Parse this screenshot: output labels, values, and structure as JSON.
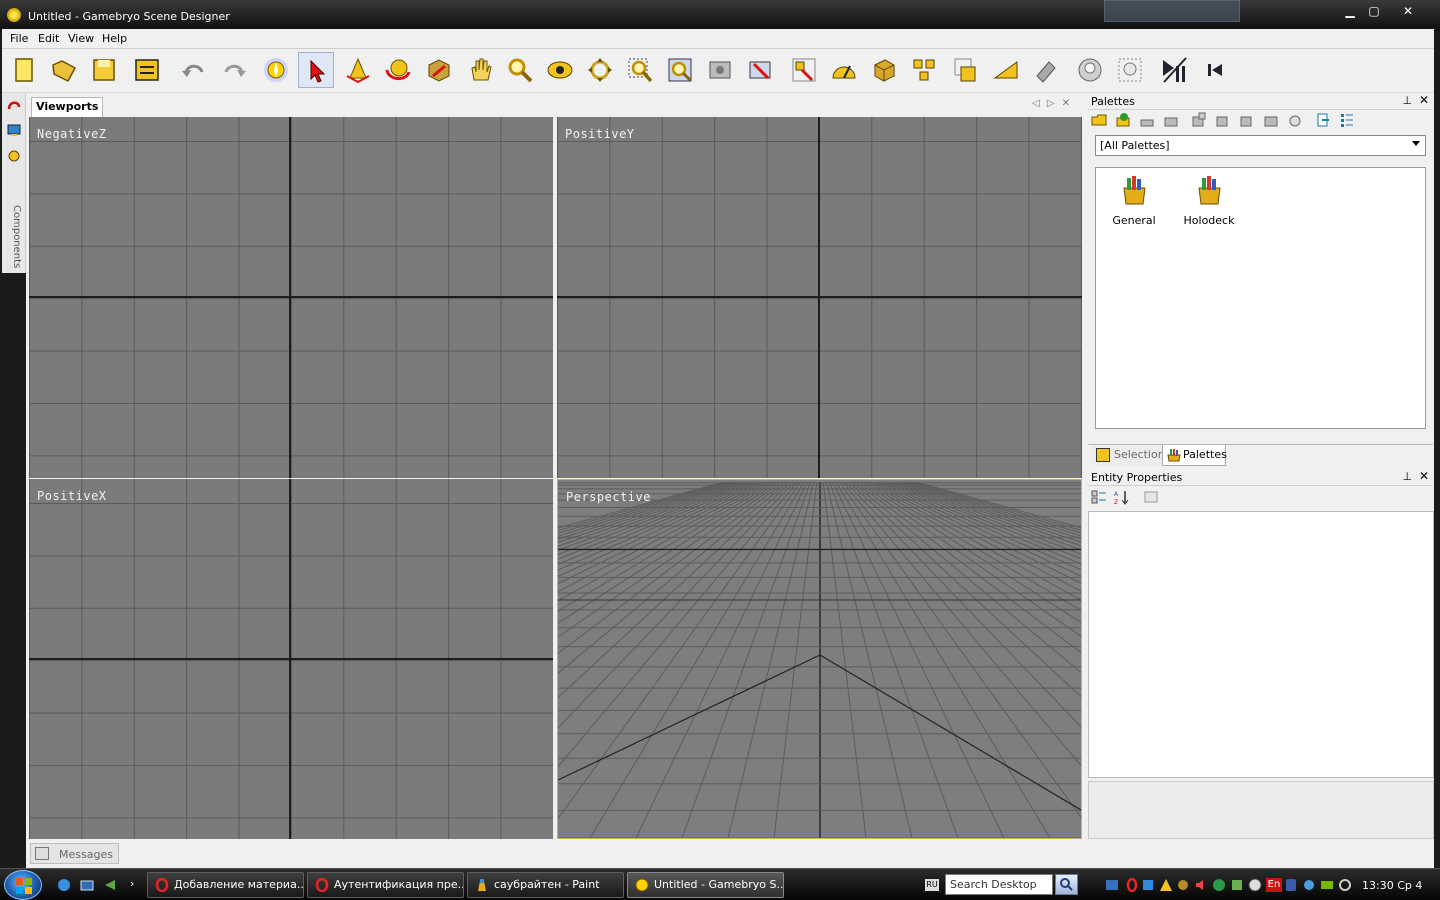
{
  "window": {
    "title": "Untitled - Gamebryo Scene Designer",
    "controls": {
      "minimize": "▁",
      "maximize": "▢",
      "close": "✕"
    }
  },
  "menu": [
    "File",
    "Edit",
    "View",
    "Help"
  ],
  "toolbar": {
    "buttons": [
      "new-file-icon",
      "open-folder-icon",
      "save-icon",
      "layout-icon",
      "undo-icon",
      "redo-icon",
      "snap-target-icon",
      "select-arrow-icon",
      "move-icon",
      "rotate-icon",
      "scale-icon",
      "pan-hand-icon",
      "zoom-icon",
      "orbit-eye-icon",
      "dolly-icon",
      "zoom-region-icon",
      "zoom-extents-icon",
      "safe-frame-icon",
      "camera-view-icon",
      "snap-grid-icon",
      "angle-snap-icon",
      "box-icon",
      "group-icon",
      "bounds-icon",
      "ramp-icon",
      "brush-icon",
      "light-icon",
      "light-settings-icon",
      "play-pause-icon",
      "skip-start-icon"
    ]
  },
  "sidebar": {
    "label": "Components"
  },
  "viewports": {
    "tab_label": "Viewports",
    "items": [
      {
        "label": "NegativeZ"
      },
      {
        "label": "PositiveY"
      },
      {
        "label": "PositiveX"
      },
      {
        "label": "Perspective"
      }
    ]
  },
  "messages": {
    "label": "Messages"
  },
  "palettes": {
    "title": "Palettes",
    "filter_value": "[All Palettes]",
    "items": [
      {
        "label": "General"
      },
      {
        "label": "Holodeck"
      }
    ],
    "tabs": [
      {
        "label": "Selection",
        "active": false
      },
      {
        "label": "Palettes",
        "active": true
      }
    ]
  },
  "entity_properties": {
    "title": "Entity Properties"
  },
  "taskbar": {
    "tasks": [
      {
        "label": "Добавление материа...",
        "icon": "opera-icon"
      },
      {
        "label": "Аутентификация пре...",
        "icon": "opera-icon"
      },
      {
        "label": "саубрайтен - Paint",
        "icon": "paint-icon"
      },
      {
        "label": "Untitled - Gamebryo S...",
        "icon": "gamebryo-icon"
      }
    ],
    "language": "RU",
    "search_placeholder": "Search Desktop",
    "tray_language": "En",
    "clock": "13:30 Ср 4"
  }
}
